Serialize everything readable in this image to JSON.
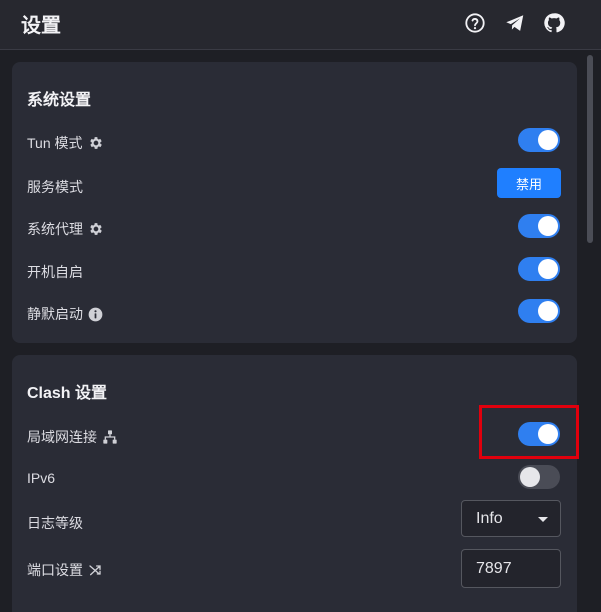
{
  "header": {
    "title": "设置",
    "icons": [
      "help-circle-icon",
      "telegram-icon",
      "github-icon"
    ]
  },
  "system_settings": {
    "title": "系统设置",
    "tun_mode": {
      "label": "Tun 模式",
      "icon": "gear-icon",
      "enabled": true
    },
    "service_mode": {
      "label": "服务模式",
      "button_label": "禁用"
    },
    "system_proxy": {
      "label": "系统代理",
      "icon": "gear-icon",
      "enabled": true
    },
    "auto_launch": {
      "label": "开机自启",
      "enabled": true
    },
    "silent_start": {
      "label": "静默启动",
      "icon": "info-icon",
      "enabled": true
    }
  },
  "clash_settings": {
    "title": "Clash 设置",
    "allow_lan": {
      "label": "局域网连接",
      "icon": "network-icon",
      "enabled": true
    },
    "ipv6": {
      "label": "IPv6",
      "enabled": false
    },
    "log_level": {
      "label": "日志等级",
      "selected": "Info"
    },
    "port": {
      "label": "端口设置",
      "icon": "shuffle-icon",
      "value": "7897"
    }
  },
  "colors": {
    "accent": "#2f7ff0",
    "button": "#1f7fff",
    "highlight": "#e1000d",
    "background": "#1e1f25",
    "card": "#2a2c36"
  }
}
